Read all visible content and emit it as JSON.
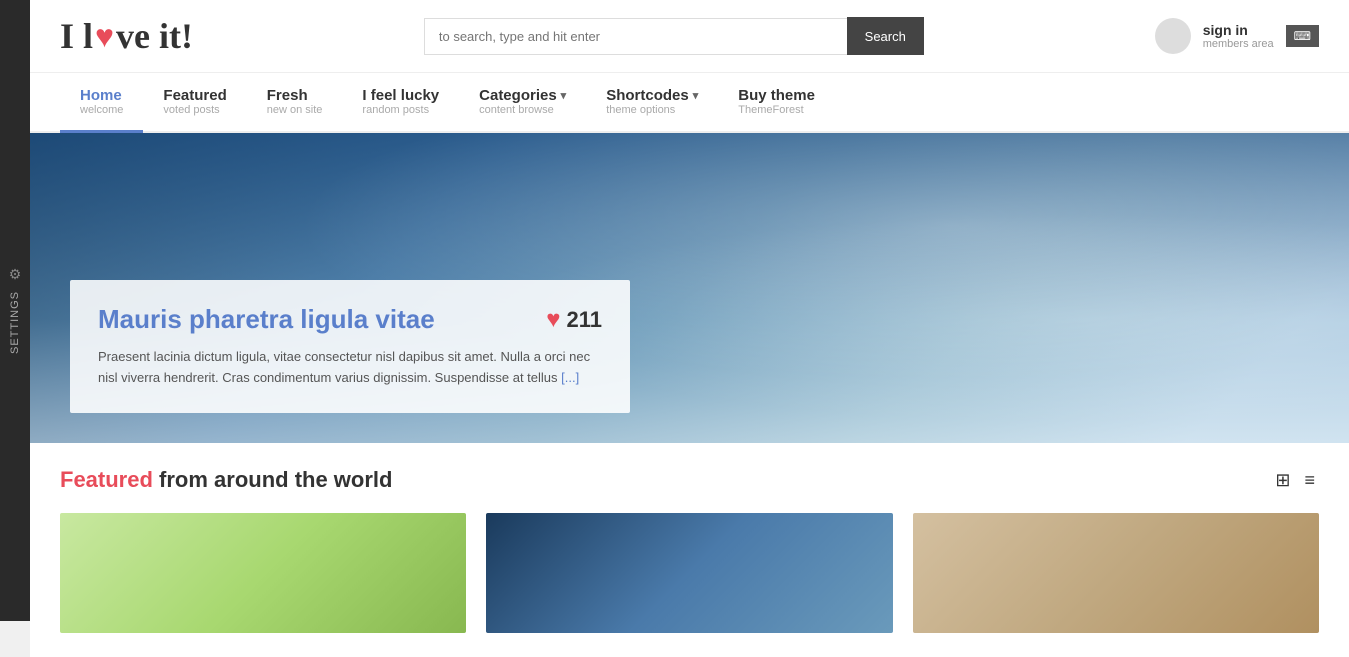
{
  "settings": {
    "label": "Settings",
    "gear": "⚙"
  },
  "header": {
    "logo_text_before": "I l",
    "logo_heart": "♥",
    "logo_text_after": "ve it!",
    "search_placeholder": "to search, type and hit enter",
    "search_button_label": "Search",
    "sign_in_label": "sign in",
    "members_area_label": "members area",
    "keyboard_icon": "⌨"
  },
  "nav": {
    "items": [
      {
        "id": "home",
        "label": "Home",
        "sublabel": "welcome",
        "active": true,
        "has_arrow": false
      },
      {
        "id": "featured",
        "label": "Featured",
        "sublabel": "voted posts",
        "active": false,
        "has_arrow": false
      },
      {
        "id": "fresh",
        "label": "Fresh",
        "sublabel": "new on site",
        "active": false,
        "has_arrow": false
      },
      {
        "id": "ifeellucky",
        "label": "I feel lucky",
        "sublabel": "random posts",
        "active": false,
        "has_arrow": false
      },
      {
        "id": "categories",
        "label": "Categories",
        "sublabel": "content browse",
        "active": false,
        "has_arrow": true
      },
      {
        "id": "shortcodes",
        "label": "Shortcodes",
        "sublabel": "theme options",
        "active": false,
        "has_arrow": true
      },
      {
        "id": "buytheme",
        "label": "Buy theme",
        "sublabel": "ThemeForest",
        "active": false,
        "has_arrow": false
      }
    ]
  },
  "hero": {
    "title": "Mauris pharetra ligula vitae",
    "likes": "211",
    "excerpt": "Praesent lacinia dictum ligula, vitae consectetur nisl dapibus sit amet. Nulla a orci nec nisl viverra hendrerit. Cras condimentum varius dignissim. Suspendisse at tellus",
    "read_more": "[...]"
  },
  "featured_section": {
    "title_accent": "Featured",
    "title_rest": " from around the world",
    "grid_icon": "⊞",
    "list_icon": "≡"
  }
}
